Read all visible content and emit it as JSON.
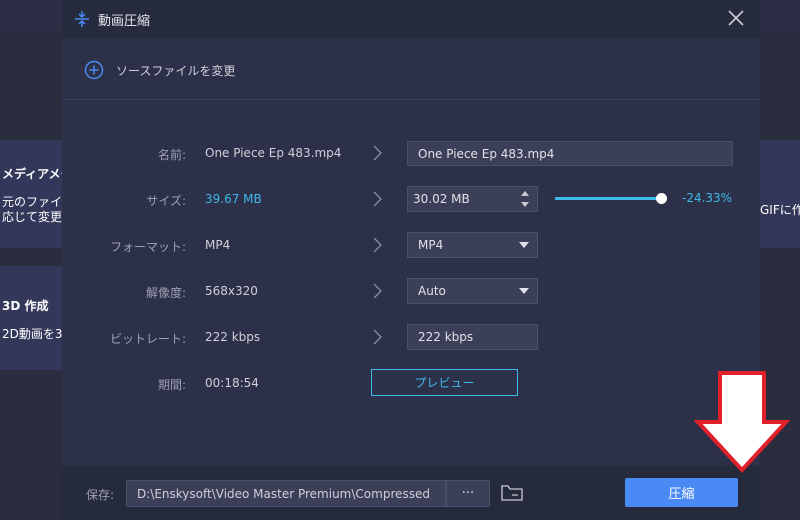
{
  "background": {
    "card1_title": "メディアメタ",
    "card1_line1": "元のファイル",
    "card1_line2": "応じて変更",
    "card2_title": "3D 作成",
    "card2_line1": "2D動画を3",
    "right_card_text": "GIFに作"
  },
  "dialog": {
    "title": "動画圧縮",
    "change_source_label": "ソースファイルを変更",
    "rows": {
      "name": {
        "label": "名前:",
        "source": "One Piece Ep 483.mp4",
        "target": "One Piece Ep 483.mp4"
      },
      "size": {
        "label": "サイズ:",
        "source": "39.67 MB",
        "target": "30.02 MB",
        "percent": "-24.33%",
        "slider_fraction": 0.9
      },
      "format": {
        "label": "フォーマット:",
        "source": "MP4",
        "target": "MP4"
      },
      "resolution": {
        "label": "解像度:",
        "source": "568x320",
        "target": "Auto"
      },
      "bitrate": {
        "label": "ビットレート:",
        "source": "222 kbps",
        "target": "222 kbps"
      },
      "duration": {
        "label": "期間:",
        "source": "00:18:54"
      }
    },
    "preview_label": "プレビュー",
    "footer": {
      "save_label": "保存:",
      "save_path": "D:\\Enskysoft\\Video Master Premium\\Compressed",
      "more_label": "···",
      "compress_label": "圧縮"
    }
  },
  "colors": {
    "accent": "#3fb9ea",
    "primary_button": "#4a8af4",
    "annotation_arrow": "#e0202a"
  }
}
